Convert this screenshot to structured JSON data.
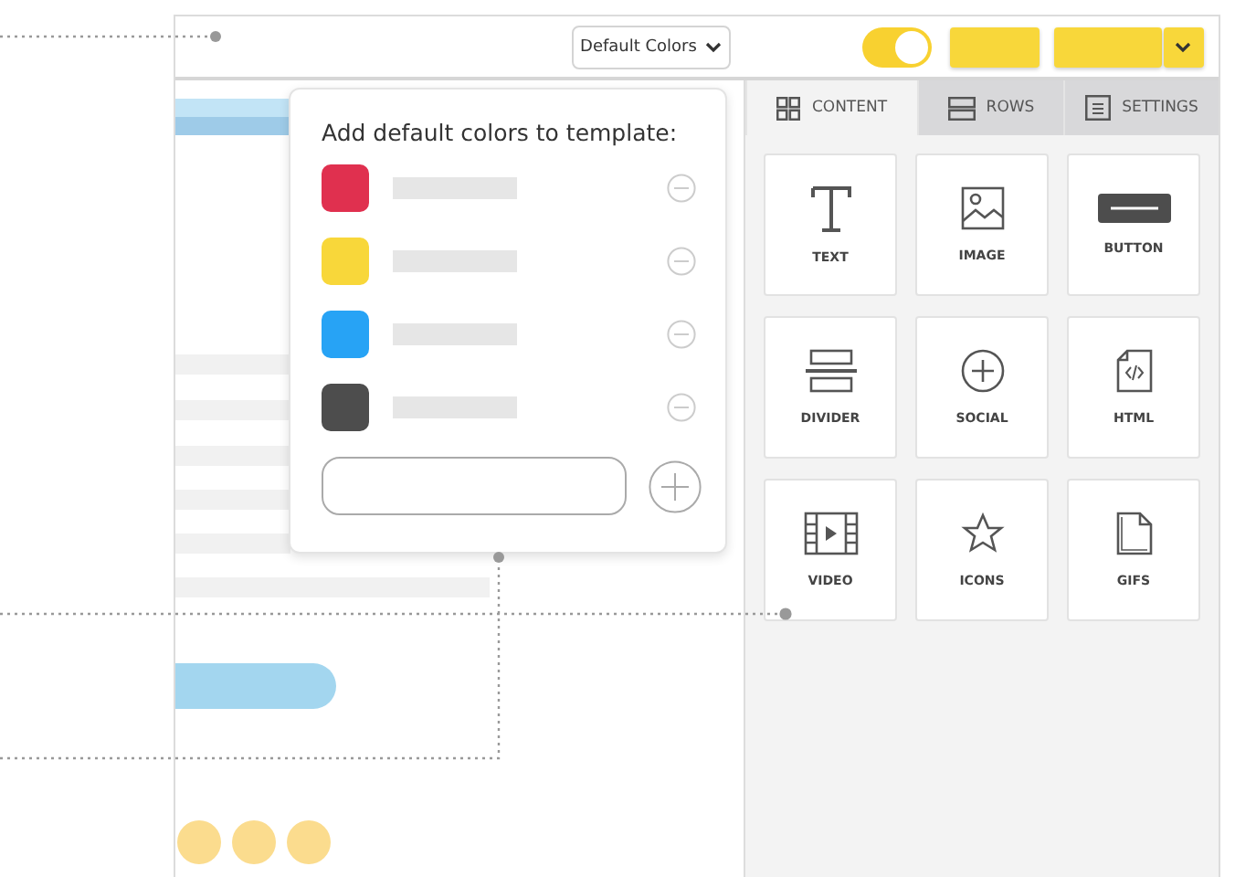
{
  "toolbar": {
    "dropdown": {
      "label": "Default Colors"
    },
    "toggle": {
      "on": true
    }
  },
  "popover": {
    "title": "Add default colors to template:",
    "colors": [
      {
        "color": "#e0304f"
      },
      {
        "color": "#f8d73a"
      },
      {
        "color": "#27a3f5"
      },
      {
        "color": "#4d4d4d"
      }
    ]
  },
  "tabs": [
    {
      "label": "CONTENT",
      "selected": true
    },
    {
      "label": "ROWS",
      "selected": false
    },
    {
      "label": "SETTINGS",
      "selected": false
    }
  ],
  "tiles": [
    {
      "label": "TEXT",
      "kind": "text"
    },
    {
      "label": "IMAGE",
      "kind": "image"
    },
    {
      "label": "BUTTON",
      "kind": "button"
    },
    {
      "label": "DIVIDER",
      "kind": "divider"
    },
    {
      "label": "SOCIAL",
      "kind": "social"
    },
    {
      "label": "HTML",
      "kind": "html"
    },
    {
      "label": "VIDEO",
      "kind": "video"
    },
    {
      "label": "ICONS",
      "kind": "icons"
    },
    {
      "label": "GIFS",
      "kind": "gifs"
    }
  ]
}
